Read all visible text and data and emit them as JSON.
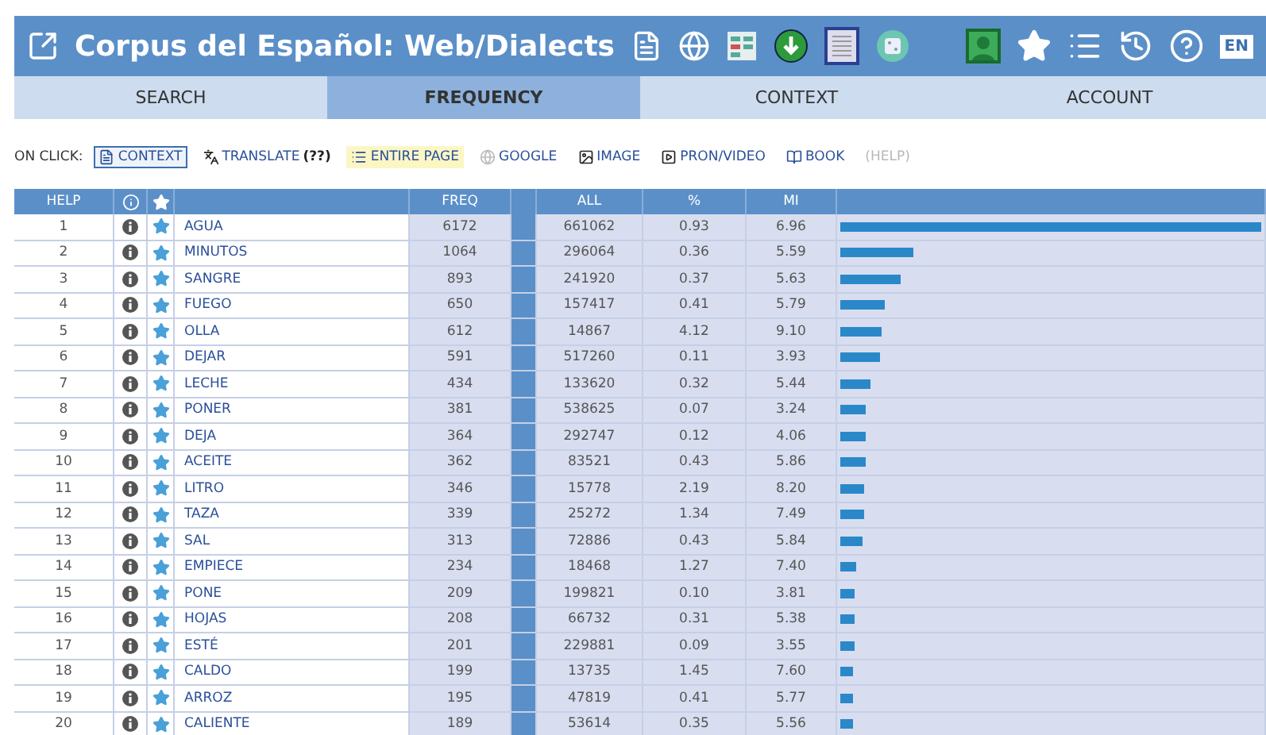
{
  "header": {
    "title": "Corpus del Español: Web/Dialects",
    "language": "EN"
  },
  "tabs": [
    {
      "label": "SEARCH",
      "selected": false
    },
    {
      "label": "FREQUENCY",
      "selected": true
    },
    {
      "label": "CONTEXT",
      "selected": false
    },
    {
      "label": "ACCOUNT",
      "selected": false
    }
  ],
  "on_click": {
    "label": "ON CLICK:",
    "options": [
      {
        "kind": "context",
        "label": "CONTEXT",
        "selected": true,
        "highlighted": false,
        "disabled": false
      },
      {
        "kind": "translate",
        "label": "TRANSLATE",
        "note": "(??)",
        "selected": false,
        "highlighted": false,
        "disabled": false
      },
      {
        "kind": "page",
        "label": "ENTIRE PAGE",
        "selected": false,
        "highlighted": true,
        "disabled": false
      },
      {
        "kind": "google",
        "label": "GOOGLE",
        "selected": false,
        "highlighted": false,
        "disabled": false
      },
      {
        "kind": "image",
        "label": "IMAGE",
        "selected": false,
        "highlighted": false,
        "disabled": false
      },
      {
        "kind": "video",
        "label": "PRON/VIDEO",
        "selected": false,
        "highlighted": false,
        "disabled": false
      },
      {
        "kind": "book",
        "label": "BOOK",
        "selected": false,
        "highlighted": false,
        "disabled": false
      },
      {
        "kind": "help",
        "label": "(HELP)",
        "selected": false,
        "highlighted": false,
        "disabled": true
      }
    ]
  },
  "table": {
    "columns": {
      "help": "HELP",
      "freq": "FREQ",
      "all": "ALL",
      "pct": "%",
      "mi": "MI"
    },
    "rows": [
      {
        "n": "1",
        "word": "AGUA",
        "freq": "6172",
        "all": "661062",
        "pct": "0.93",
        "mi": "6.96",
        "level": 1
      },
      {
        "n": "2",
        "word": "MINUTOS",
        "freq": "1064",
        "all": "296064",
        "pct": "0.36",
        "mi": "5.59",
        "level": 0.172
      },
      {
        "n": "3",
        "word": "SANGRE",
        "freq": "893",
        "all": "241920",
        "pct": "0.37",
        "mi": "5.63",
        "level": 0.145
      },
      {
        "n": "4",
        "word": "FUEGO",
        "freq": "650",
        "all": "157417",
        "pct": "0.41",
        "mi": "5.79",
        "level": 0.105
      },
      {
        "n": "5",
        "word": "OLLA",
        "freq": "612",
        "all": "14867",
        "pct": "4.12",
        "mi": "9.10",
        "level": 0.099
      },
      {
        "n": "6",
        "word": "DEJAR",
        "freq": "591",
        "all": "517260",
        "pct": "0.11",
        "mi": "3.93",
        "level": 0.096
      },
      {
        "n": "7",
        "word": "LECHE",
        "freq": "434",
        "all": "133620",
        "pct": "0.32",
        "mi": "5.44",
        "level": 0.07
      },
      {
        "n": "8",
        "word": "PONER",
        "freq": "381",
        "all": "538625",
        "pct": "0.07",
        "mi": "3.24",
        "level": 0.062
      },
      {
        "n": "9",
        "word": "DEJA",
        "freq": "364",
        "all": "292747",
        "pct": "0.12",
        "mi": "4.06",
        "level": 0.059
      },
      {
        "n": "10",
        "word": "ACEITE",
        "freq": "362",
        "all": "83521",
        "pct": "0.43",
        "mi": "5.86",
        "level": 0.059
      },
      {
        "n": "11",
        "word": "LITRO",
        "freq": "346",
        "all": "15778",
        "pct": "2.19",
        "mi": "8.20",
        "level": 0.056
      },
      {
        "n": "12",
        "word": "TAZA",
        "freq": "339",
        "all": "25272",
        "pct": "1.34",
        "mi": "7.49",
        "level": 0.055
      },
      {
        "n": "13",
        "word": "SAL",
        "freq": "313",
        "all": "72886",
        "pct": "0.43",
        "mi": "5.84",
        "level": 0.051
      },
      {
        "n": "14",
        "word": "EMPIECE",
        "freq": "234",
        "all": "18468",
        "pct": "1.27",
        "mi": "7.40",
        "level": 0.038
      },
      {
        "n": "15",
        "word": "PONE",
        "freq": "209",
        "all": "199821",
        "pct": "0.10",
        "mi": "3.81",
        "level": 0.034
      },
      {
        "n": "16",
        "word": "HOJAS",
        "freq": "208",
        "all": "66732",
        "pct": "0.31",
        "mi": "5.38",
        "level": 0.034
      },
      {
        "n": "17",
        "word": "ESTÉ",
        "freq": "201",
        "all": "229881",
        "pct": "0.09",
        "mi": "3.55",
        "level": 0.033
      },
      {
        "n": "18",
        "word": "CALDO",
        "freq": "199",
        "all": "13735",
        "pct": "1.45",
        "mi": "7.60",
        "level": 0.032
      },
      {
        "n": "19",
        "word": "ARROZ",
        "freq": "195",
        "all": "47819",
        "pct": "0.41",
        "mi": "5.77",
        "level": 0.032
      },
      {
        "n": "20",
        "word": "CALIENTE",
        "freq": "189",
        "all": "53614",
        "pct": "0.35",
        "mi": "5.56",
        "level": 0.031
      }
    ]
  }
}
